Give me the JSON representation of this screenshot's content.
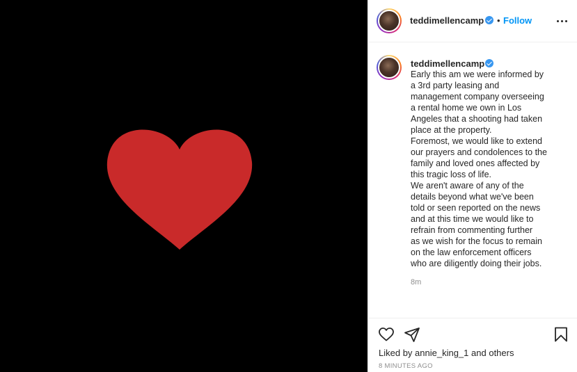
{
  "post": {
    "username": "teddimellencamp",
    "verified": true,
    "follow_label": "Follow",
    "separator": "•",
    "caption": "Early this am we were informed by\na 3rd party leasing and\nmanagement company overseeing\na rental home we own in Los\nAngeles that a shooting had taken\nplace at the property.\nForemost, we would like to extend\nour prayers and condolences to the\nfamily and loved ones affected by\nthis tragic loss of life.\nWe aren't aware of any of the\ndetails beyond what we've been\ntold or seen reported on the news\nand at this time we would like to\nrefrain from commenting further\nas we wish for the focus to remain\non the law enforcement officers\nwho are diligently doing their jobs.",
    "caption_age": "8m",
    "liked_prefix": "Liked by",
    "liked_user": "annie_king_1",
    "liked_suffix": "and others",
    "timestamp": "8 MINUTES AGO"
  },
  "media": {
    "background": "#000000",
    "heart_color": "#c92a2a"
  },
  "icons": {
    "like": "heart-outline-icon",
    "share": "paper-plane-icon",
    "save": "bookmark-icon",
    "more": "more-options-icon"
  },
  "colors": {
    "accent": "#0095f6",
    "verified": "#3897f0",
    "muted": "#8e8e8e"
  }
}
